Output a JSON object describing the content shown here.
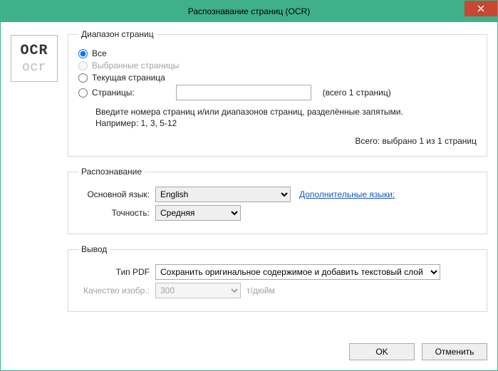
{
  "title": "Распознавание страниц (OCR)",
  "range": {
    "legend": "Диапазон страниц",
    "all": "Все",
    "selected": "Выбранные страницы",
    "current": "Текущая страница",
    "pages_label": "Страницы:",
    "pages_value": "",
    "pages_total_hint": "(всего 1 страниц)",
    "hint_line1": "Введите номера страниц и/или диапазонов страниц, разделённые запятыми.",
    "hint_line2": "Например: 1, 3, 5-12",
    "total_selected": "Всего: выбрано 1 из 1 страниц"
  },
  "recognition": {
    "legend": "Распознавание",
    "lang_label": "Основной язык:",
    "lang_value": "English",
    "more_langs": "Дополнительные языки:",
    "accuracy_label": "Точность:",
    "accuracy_value": "Средняя"
  },
  "output": {
    "legend": "Вывод",
    "pdf_type_label": "Тип PDF",
    "pdf_type_value": "Сохранить оригинальное содержимое и добавить текстовый слой",
    "quality_label": "Качество изобр.:",
    "quality_value": "300",
    "quality_unit": "т/дюйм"
  },
  "buttons": {
    "ok": "OK",
    "cancel": "Отменить"
  }
}
